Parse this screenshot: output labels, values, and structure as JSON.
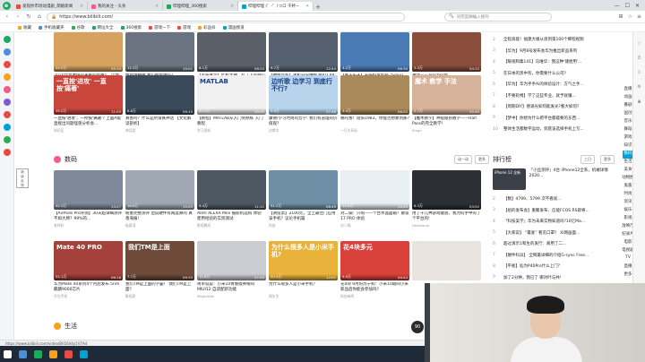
{
  "tabs": [
    {
      "label": "发现你市场动漫剧_萌娘新闻",
      "color": "#e54d42"
    },
    {
      "label": "我的关注 - 头条",
      "color": "#f25d8e"
    },
    {
      "label": "哔哩哔哩_360搜索",
      "color": "#1aab5f"
    },
    {
      "label": "哔哩哔哩 (゜-゜)つロ 干杯~",
      "color": "#00a1d6",
      "active": true
    }
  ],
  "address": {
    "url": "https://www.bilibili.com/",
    "search_placeholder": "问完篮搁编入搜刊"
  },
  "bookmarks": [
    "收藏",
    "手机收藏夹",
    "谷歌",
    "网址大全",
    "360搜索",
    "游戏一下",
    "游戏",
    "彩品抖",
    "漫画频道"
  ],
  "section1": {
    "row1": [
      {
        "title": "2020立夏季值得来看的新番5，让你乐翻到100%等你...",
        "up": "王大丽",
        "views": "24.5万",
        "dur": "05:14",
        "color": "#d7a25f"
      },
      {
        "title": "性能爆棚中 我们都能用吗?",
        "up": "小叮当",
        "views": "12.3万",
        "dur": "10:01",
        "color": "#6b7280"
      },
      {
        "title": "【美味真玩】挂机大神，打工人的贴心 Beta版 (Brainwaves)",
        "up": "科技宅",
        "views": "8.1万",
        "dur": "08:20",
        "color": "#5a5f68"
      },
      {
        "title": "【硬件玩家】手机分分钟跑 MATLAB入门到精通视频",
        "up": "数码君",
        "views": "9.7万",
        "dur": "12:44",
        "color": "#55616e"
      },
      {
        "title": "【真千乐天】安倍好爱科技 (Sony)",
        "up": "Kinner",
        "views": "4.2万",
        "dur": "06:30",
        "color": "#4a7bb5"
      },
      {
        "title": "神话——Teacher新",
        "up": "一片瓦",
        "views": "3.3万",
        "dur": "04:12",
        "color": "#8b4d3b"
      }
    ],
    "row2": [
      {
        "title": "一直按'进攻'，一所按'痛著'? 上面A能直接出问题怪兽分析会...",
        "up": "知识区",
        "views": "15.2万",
        "dur": "11:03",
        "caption": "一直按'进攻' 一直按'痛著'",
        "color": "#c9463d"
      },
      {
        "title": "真香吗？什么是所谓真神话 【文化解读剖析】",
        "up": "神话君",
        "views": "6.8万",
        "dur": "09:15",
        "caption": "",
        "color": "#3b4a5a"
      },
      {
        "title": "【教程】MATLAB从入门到熟练 入门教程",
        "up": "学习资料",
        "views": "22.1万",
        "dur": "45:00",
        "caption": "MATLAB",
        "color": "#f0f0f0"
      },
      {
        "title": "康德/学习时尚的哲学: 我们有道理的价值观?",
        "up": "边缘学",
        "views": "5.6万",
        "dur": "07:48",
        "caption": "边听歌 边学习 到底行不行?",
        "color": "#b7d4ec"
      },
      {
        "title": "哪吒叛！屈阳1983，你能否想象到那?",
        "up": "一只大耳朵",
        "views": "3.9万",
        "dur": "06:02",
        "caption": "",
        "color": "#aa8a5a"
      },
      {
        "title": "【魔术教学】神般级别教学——Half Pass的完全教学！",
        "up": "Elega",
        "views": "2.7万",
        "dur": "05:40",
        "caption": "魔术 教学 手法",
        "color": "#d6b29a"
      }
    ]
  },
  "section_digital": {
    "title": "数码",
    "btn_dynamic": "动一动",
    "btn_more": "更多",
    "row1": [
      {
        "title": "【AirPods Pro评测】30天超详细测评不如大牌？99%的...",
        "up": "老师好",
        "views": "42.3万",
        "dur": "13:27",
        "color": "#7e8a9a"
      },
      {
        "title": "粉墨完整测评 边说硬件有网度算的 真香海报!",
        "up": "极客湾",
        "views": "18.6万",
        "dur": "15:05",
        "color": "#a0a9b3"
      },
      {
        "title": "ARRI ALEXA Mini 摄影机选购 体验 使用经验的实际测试",
        "up": "影视飓风",
        "views": "9.4万",
        "dur": "11:11",
        "color": "#4e5862"
      },
      {
        "title": "【请投票】2100元，全上最佳门应用该手机？议论手机篇",
        "up": "科技",
        "views": "31.2万",
        "dur": "08:49",
        "color": "#6f8fa7"
      },
      {
        "title": "对二锅：只购——个台水晶面箱？散谈17 PRO 体验",
        "up": "对二锅",
        "views": "12.0万",
        "dur": "10:20",
        "color": "#e9eef2"
      },
      {
        "title": "用了十几种游戏键盘，我为何手中的了个平台的!",
        "up": "Headlamp",
        "views": "6.3万",
        "dur": "03:52",
        "color": "#2c2f35"
      }
    ],
    "row2": [
      {
        "title": "华为Mate 40系列4个月后发布 5nm麒麟9000芯片",
        "up": "华为手机",
        "views": "55.1万",
        "dur": "06:18",
        "caption": "Mate 40 PRO",
        "color": "#a3413a"
      },
      {
        "title": "我们TM是上面的学霸！ 我们TM是上面?",
        "up": "影视君",
        "views": "7.7万",
        "dur": "09:33",
        "caption": "我们TM是上面",
        "color": "#6d4a3a"
      },
      {
        "title": "简单说说：小米10青春版养眼吗 MIUI12 自适配新功能",
        "up": "MagicWiki",
        "views": "11.8万",
        "dur": "07:05",
        "caption": "",
        "color": "#c9ccd1"
      },
      {
        "title": "为什么很多人是小米手机？",
        "up": "闻头生",
        "views": "20.4万",
        "dur": "12:01",
        "caption": "为什么很多人是小米手机?",
        "color": "#e9b23a"
      },
      {
        "title": "花4块 9月份苏宁购：小米10期间小米新品后你能会参加吗?",
        "up": "科技新闻",
        "views": "9.9万",
        "dur": "04:44",
        "caption": "花4块多元",
        "color": "#d9413a"
      },
      {
        "title": "",
        "up": "",
        "views": "",
        "dur": "",
        "caption": "",
        "color": "#e9e3e0"
      }
    ]
  },
  "section_life": {
    "title": "生活"
  },
  "rank_top": [
    {
      "num": "2",
      "text": "全程高能！福建大娘从恩到第100个蝉程视频"
    },
    {
      "num": "3",
      "text": "【华为】9月8号发布会华为推出新品系列"
    },
    {
      "num": "4",
      "text": "【暖视和集141】马唯华：我这种'储尝用'..."
    },
    {
      "num": "5",
      "text": "在日本的黑中有，你需要什么公司?"
    },
    {
      "num": "6",
      "text": "【华为】华为手手Ai的体验设计：方气之手..."
    },
    {
      "num": "7",
      "text": "【不要轮椅】学了这些专业，就予就懂..."
    },
    {
      "num": "8",
      "text": "【周期DIY】德涌光如何能发光?看大如何?"
    },
    {
      "num": "9",
      "text": "【梦中】你想为什么把平台都能要的东西..."
    },
    {
      "num": "10",
      "text": "整体生活都数字运动，到底该选择手机上写..."
    }
  ],
  "rank2": {
    "title": "排行榜",
    "tab1": "三日",
    "more": "更多",
    "feature": {
      "thumb": "iPhone 12 全新",
      "text": "「小丝测评」4台 iPhone12全系，机械详情 2020..."
    },
    "items": [
      {
        "num": "2",
        "text": "【数】4799、5799 次不看就..."
      },
      {
        "num": "3",
        "text": "【组的发布会】重聚发布、信能FCOS RS即将..."
      },
      {
        "num": "4",
        "text": "「科技美学」华为未来实物知道吗?10亿Ma..."
      },
      {
        "num": "5",
        "text": "【大家说】 “最爱” 看见口罩？ 众网画面..."
      },
      {
        "num": "6",
        "text": "超过演示1和生的发行：真用了二..."
      },
      {
        "num": "7",
        "text": "【硬件科派】 全网最详细的介绍G-sync Free..."
      },
      {
        "num": "8",
        "text": "【平板】仙为P40Pro什么上门？"
      },
      {
        "num": "9",
        "text": "加了2分钟，我已了 哪对叶与共!"
      },
      {
        "num": "10",
        "text": "能发达于人，为什么公益是课?"
      }
    ]
  },
  "right_nav": [
    "直播",
    "动画",
    "番剧",
    "国创",
    "音乐",
    "舞蹈",
    "游戏",
    "知识",
    "数码",
    "生活",
    "美食",
    "动物圈",
    "鬼畜",
    "时尚",
    "资讯",
    "娱乐",
    "影视",
    "放映厅",
    "纪录片",
    "电影",
    "电视剧",
    "TV",
    "直播",
    "更多"
  ],
  "status": {
    "text": "https://www.bilibili.com/video/BV1644y1V7A4"
  },
  "taskbar": {
    "time": "13:45",
    "date": "2020/7/17 星期五"
  },
  "float_button": "90"
}
